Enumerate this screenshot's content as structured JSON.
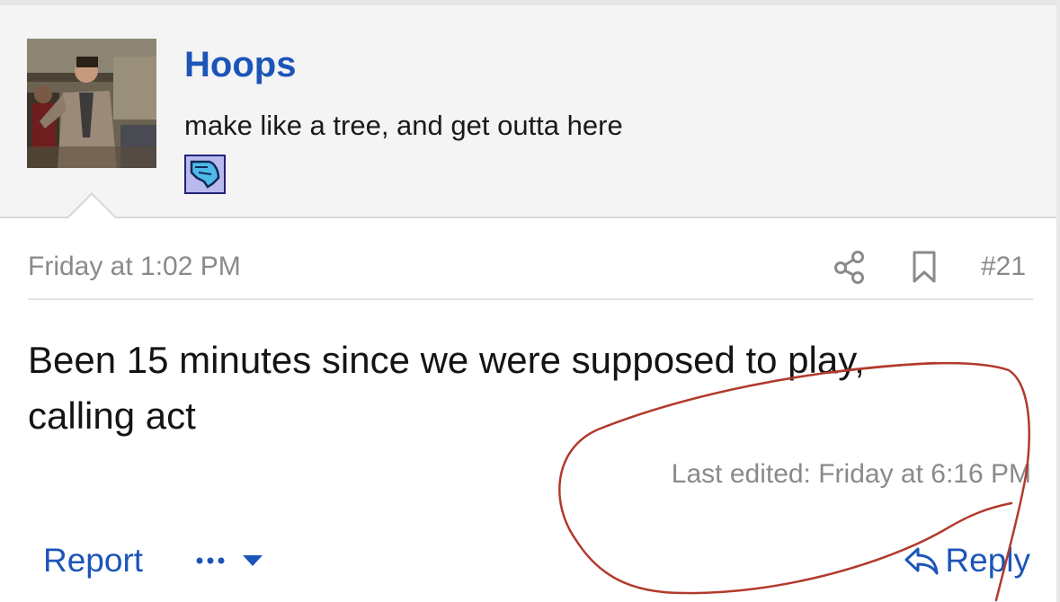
{
  "user": {
    "name": "Hoops",
    "title": "make like a tree, and get outta here"
  },
  "post": {
    "date": "Friday at 1:02 PM",
    "number": "#21",
    "body_line1": "Been 15 minutes since we were supposed to play,",
    "body_line2": "calling act",
    "last_edited": "Last edited: Friday at 6:16 PM"
  },
  "actions": {
    "report": "Report",
    "more": "•••",
    "reply": "Reply"
  },
  "icons": {
    "share": "share-icon",
    "bookmark": "bookmark-icon",
    "reply": "reply-arrow-icon",
    "more": "chevron-down-icon",
    "badge": "flag-badge-icon"
  },
  "colors": {
    "link": "#1c55b8",
    "muted": "#8a8a8a",
    "user_block_bg": "#f4f4f4",
    "annotation": "#b23a2c"
  }
}
